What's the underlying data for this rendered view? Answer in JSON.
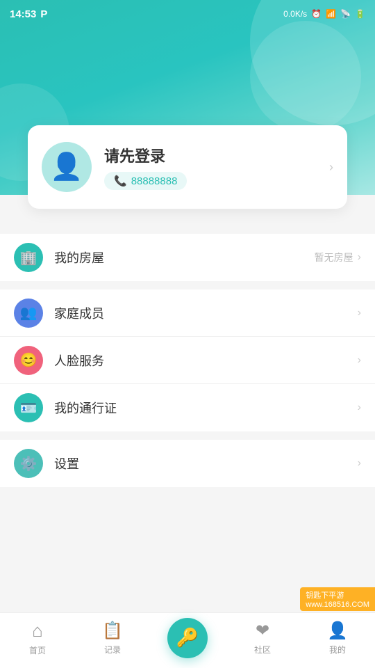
{
  "statusBar": {
    "time": "14:53",
    "parkingIcon": "P",
    "speed": "0.0K/s",
    "icons": [
      "alarm",
      "signal",
      "wifi",
      "battery"
    ]
  },
  "header": {
    "bgColors": [
      "#2bbfb3",
      "#5dd4cc"
    ]
  },
  "profile": {
    "loginPrompt": "请先登录",
    "phoneNumber": "88888888",
    "phoneIcon": "📞"
  },
  "menuSections": [
    {
      "items": [
        {
          "id": "my-house",
          "label": "我的房屋",
          "rightText": "暂无房屋",
          "iconBg": "icon-green",
          "icon": "🏢"
        }
      ]
    },
    {
      "items": [
        {
          "id": "family-members",
          "label": "家庭成员",
          "rightText": "",
          "iconBg": "icon-blue",
          "icon": "👥"
        },
        {
          "id": "face-service",
          "label": "人脸服务",
          "rightText": "",
          "iconBg": "icon-pink",
          "icon": "😊"
        },
        {
          "id": "my-pass",
          "label": "我的通行证",
          "rightText": "",
          "iconBg": "icon-teal",
          "icon": "🪪"
        }
      ]
    },
    {
      "items": [
        {
          "id": "settings",
          "label": "设置",
          "rightText": "",
          "iconBg": "icon-teal2",
          "icon": "⚙️"
        }
      ]
    }
  ],
  "bottomNav": [
    {
      "id": "home",
      "label": "首页",
      "icon": "⌂"
    },
    {
      "id": "records",
      "label": "记录",
      "icon": "📋"
    },
    {
      "id": "lock",
      "label": "",
      "icon": "🔑",
      "isCenter": true
    },
    {
      "id": "community",
      "label": "社区",
      "icon": "❤"
    },
    {
      "id": "profile",
      "label": "我的",
      "icon": "👤"
    }
  ],
  "watermark": "钥匙下平游\nwww.168516.COM"
}
